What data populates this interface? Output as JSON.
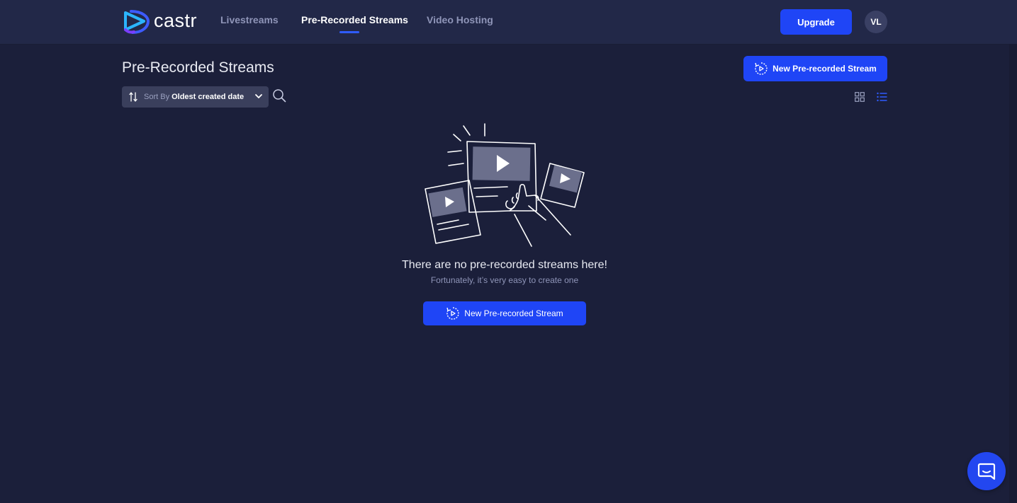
{
  "brand": {
    "name": "castr",
    "accent": "#1f45f6"
  },
  "nav": {
    "items": [
      {
        "label": "Livestreams",
        "active": false
      },
      {
        "label": "Pre-Recorded Streams",
        "active": true
      },
      {
        "label": "Video Hosting",
        "active": false
      }
    ]
  },
  "header": {
    "upgrade_label": "Upgrade",
    "avatar_initials": "VL"
  },
  "page": {
    "title": "Pre-Recorded Streams",
    "new_stream_label": "New Pre-recorded Stream"
  },
  "sort": {
    "prefix": "Sort By",
    "value": "Oldest created date"
  },
  "view": {
    "mode": "list"
  },
  "empty_state": {
    "title": "There are no pre-recorded streams here!",
    "subtitle": "Fortunately, it’s very easy to create one",
    "button_label": "New Pre-recorded Stream"
  },
  "icons": {
    "logo": "castr-logo-icon",
    "new_stream": "replay-play-icon",
    "sort": "sort-arrows-icon",
    "dropdown": "chevron-down-icon",
    "search": "search-icon",
    "grid": "grid-view-icon",
    "list": "list-view-icon",
    "chat": "chat-bubble-icon",
    "illustration": "empty-videos-illustration"
  }
}
